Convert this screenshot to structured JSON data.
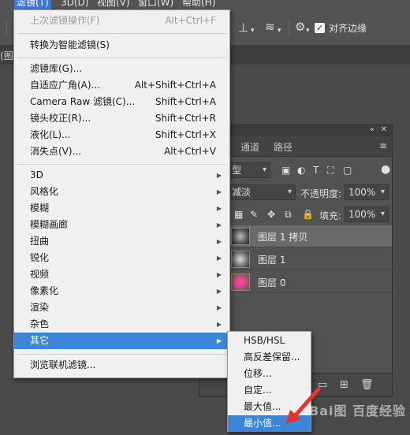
{
  "menubar": {
    "items": [
      {
        "label": "滤镜(T)",
        "active": true
      },
      {
        "label": "3D(D)",
        "active": false
      },
      {
        "label": "视图(V)",
        "active": false
      },
      {
        "label": "窗口(W)",
        "active": false
      },
      {
        "label": "帮助(H)",
        "active": false
      }
    ]
  },
  "options": {
    "align_edges_label": "对齐边缘",
    "align_edges_checked": true
  },
  "document": {
    "tab_fragment": "图"
  },
  "filter_menu": {
    "last_filter": {
      "label": "上次滤镜操作(F)",
      "shortcut": "Alt+Ctrl+F"
    },
    "smart_filter": {
      "label": "转换为智能滤镜(S)"
    },
    "group2": [
      {
        "label": "滤镜库(G)...",
        "shortcut": ""
      },
      {
        "label": "自适应广角(A)...",
        "shortcut": "Alt+Shift+Ctrl+A"
      },
      {
        "label": "Camera Raw 滤镜(C)...",
        "shortcut": "Shift+Ctrl+A"
      },
      {
        "label": "镜头校正(R)...",
        "shortcut": "Shift+Ctrl+R"
      },
      {
        "label": "液化(L)...",
        "shortcut": "Shift+Ctrl+X"
      },
      {
        "label": "消失点(V)...",
        "shortcut": "Alt+Ctrl+V"
      }
    ],
    "group3": [
      {
        "label": "3D"
      },
      {
        "label": "风格化"
      },
      {
        "label": "模糊"
      },
      {
        "label": "模糊画廊"
      },
      {
        "label": "扭曲"
      },
      {
        "label": "锐化"
      },
      {
        "label": "视频"
      },
      {
        "label": "像素化"
      },
      {
        "label": "渲染"
      },
      {
        "label": "杂色"
      },
      {
        "label": "其它"
      }
    ],
    "browse": {
      "label": "浏览联机滤镜..."
    }
  },
  "other_submenu": {
    "items": [
      {
        "label": "HSB/HSL"
      },
      {
        "label": "高反差保留..."
      },
      {
        "label": "位移..."
      },
      {
        "label": "自定..."
      },
      {
        "label": "最大值..."
      },
      {
        "label": "最小值..."
      }
    ]
  },
  "layers_panel": {
    "tabs": [
      "通道",
      "路径"
    ],
    "kind_fragment": "型",
    "blend_fragment": "减淡",
    "opacity_label": "不透明度:",
    "opacity_value": "100%",
    "fill_label": "填充:",
    "fill_value": "100%",
    "layers": [
      {
        "name": "图层 1 拷贝",
        "selected": true
      },
      {
        "name": "图层 1",
        "selected": false
      },
      {
        "name": "图层 0",
        "selected": false
      }
    ]
  },
  "watermark": "Bai图 百度经验",
  "colors": {
    "menu_highlight": "#3b86d9",
    "annotation_arrow": "#e8322d"
  }
}
